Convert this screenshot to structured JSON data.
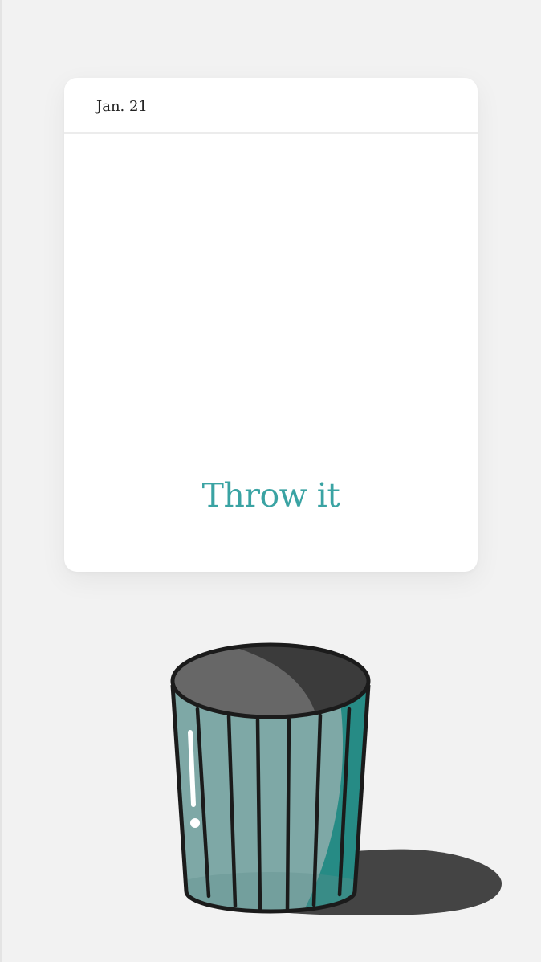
{
  "note": {
    "date": "Jan. 21",
    "body_text": "",
    "action_label": "Throw it"
  },
  "colors": {
    "background": "#f2f2f2",
    "card": "#ffffff",
    "accent": "#3aa3a3",
    "can_body": "#7ea8a6",
    "can_body_dark": "#268b85",
    "can_lid": "#676767",
    "can_lid_dark": "#3b3b3b",
    "shadow": "#444444"
  },
  "icons": {
    "trash": "trash-can-icon"
  }
}
